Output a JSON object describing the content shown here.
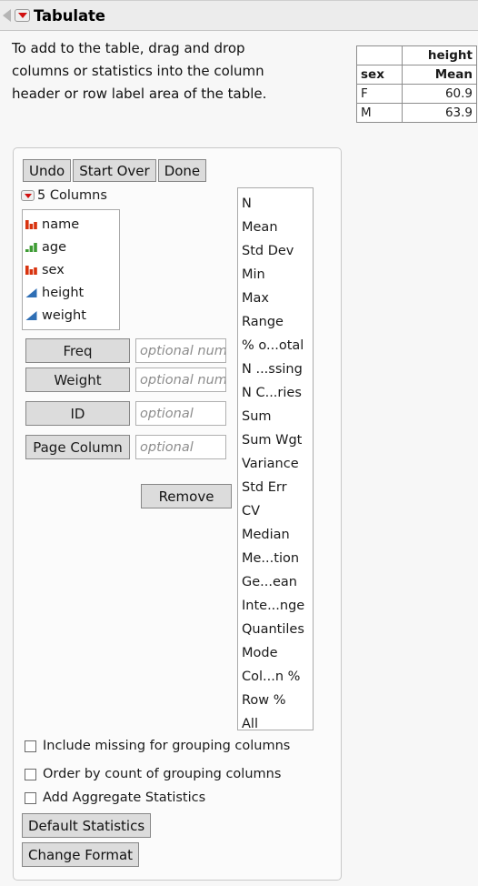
{
  "window": {
    "title": "Tabulate"
  },
  "instructions": {
    "text": "To add to the table, drag and drop columns or statistics into the column header or row label area of the table."
  },
  "result_table": {
    "corner_label": "",
    "column_group_header": "height",
    "row_label_header": "sex",
    "statistic_header": "Mean",
    "rows": [
      {
        "label": "F",
        "value": "60.9"
      },
      {
        "label": "M",
        "value": "63.9"
      }
    ]
  },
  "toolbar": {
    "undo_label": "Undo",
    "start_over_label": "Start Over",
    "done_label": "Done"
  },
  "columns_section": {
    "header_label": "5 Columns",
    "items": [
      {
        "name": "name",
        "modeling_type": "nominal",
        "icon": "nominal-bars-icon"
      },
      {
        "name": "age",
        "modeling_type": "ordinal",
        "icon": "ordinal-bars-icon"
      },
      {
        "name": "sex",
        "modeling_type": "nominal",
        "icon": "nominal-bars-icon"
      },
      {
        "name": "height",
        "modeling_type": "continuous",
        "icon": "continuous-triangle-icon"
      },
      {
        "name": "weight",
        "modeling_type": "continuous",
        "icon": "continuous-triangle-icon"
      }
    ]
  },
  "roles": [
    {
      "button_label": "Freq",
      "value": "",
      "placeholder": "optional numeric",
      "field_width": 100
    },
    {
      "button_label": "Weight",
      "value": "",
      "placeholder": "optional numeric",
      "field_width": 100
    },
    {
      "button_label": "ID",
      "value": "",
      "placeholder": "optional",
      "field_width": 100
    },
    {
      "button_label": "Page Column",
      "value": "",
      "placeholder": "optional",
      "field_width": 100
    }
  ],
  "remove_button": {
    "label": "Remove"
  },
  "statistics": [
    "N",
    "Mean",
    "Std Dev",
    "Min",
    "Max",
    "Range",
    "% o...otal",
    "N ...ssing",
    "N C...ries",
    "Sum",
    "Sum Wgt",
    "Variance",
    "Std Err",
    "CV",
    "Median",
    "Me...tion",
    "Ge...ean",
    "Inte...nge",
    "Quantiles",
    "Mode",
    "Col...n %",
    "Row %",
    "All"
  ],
  "checkboxes": [
    {
      "label": "Include missing for grouping columns",
      "checked": false
    },
    {
      "label": "Order by count of grouping columns",
      "checked": false
    },
    {
      "label": "Add Aggregate Statistics",
      "checked": false
    }
  ],
  "bottom_buttons": {
    "default_statistics_label": "Default Statistics",
    "change_format_label": "Change Format"
  },
  "colors": {
    "nominal_icon": "#d8330f",
    "ordinal_icon": "#3f9c35",
    "continuous_icon": "#2f6fb5",
    "red_triangle": "#d10f0f",
    "button_face": "#dcdcdc",
    "panel_background": "#fbfbfb",
    "window_background": "#f7f7f7",
    "titlebar_background": "#ececec"
  }
}
